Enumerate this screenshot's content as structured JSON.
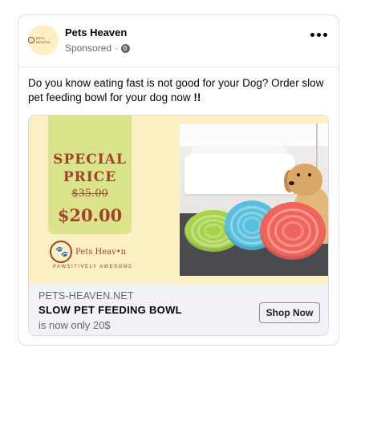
{
  "post": {
    "page_name": "Pets Heaven",
    "sponsored": "Sponsored",
    "separator": "·",
    "avatar_logo_text": "PETS HEAVEN",
    "body_text": "Do you know eating fast is not good for your Dog? Order slow pet feeding bowl for your dog now ",
    "body_emphasis": "!!"
  },
  "ad": {
    "special_line1": "SPECIAL",
    "special_line2": "PRICE",
    "old_price": "$35.00",
    "new_price": "$20.00",
    "brand_name": "Pets Heav•n",
    "brand_tagline": "PAWSITIVELY AWESOME",
    "paw_glyph": "🐾",
    "bowl_colors": [
      "#a6d34a",
      "#58bfdc",
      "#f0645c"
    ]
  },
  "link": {
    "domain": "PETS-HEAVEN.NET",
    "headline": "SLOW PET FEEDING BOWL",
    "description": "is now only 20$",
    "cta_label": "Shop Now"
  }
}
